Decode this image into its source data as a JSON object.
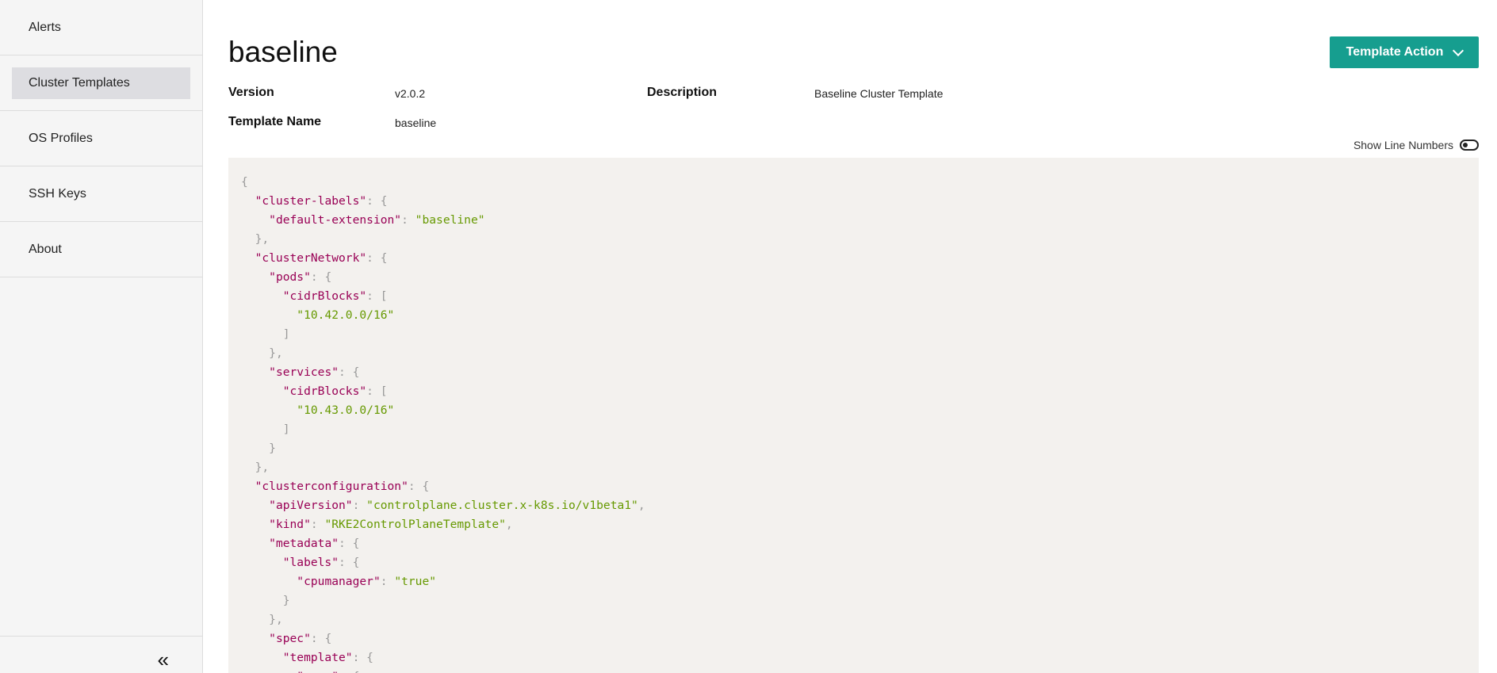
{
  "sidebar": {
    "items": [
      {
        "label": "Alerts",
        "active": false
      },
      {
        "label": "Cluster Templates",
        "active": true
      },
      {
        "label": "OS Profiles",
        "active": false
      },
      {
        "label": "SSH Keys",
        "active": false
      },
      {
        "label": "About",
        "active": false
      }
    ],
    "collapse_glyph": "«"
  },
  "header": {
    "title": "baseline",
    "action_button_label": "Template Action"
  },
  "details": {
    "version_label": "Version",
    "version_value": "v2.0.2",
    "description_label": "Description",
    "description_value": "Baseline Cluster Template",
    "template_name_label": "Template Name",
    "template_name_value": "baseline"
  },
  "code_view": {
    "show_line_numbers_label": "Show Line Numbers",
    "show_line_numbers": false,
    "lines": [
      [
        [
          "p",
          "{"
        ]
      ],
      [
        [
          "t",
          "  "
        ],
        [
          "k",
          "\"cluster-labels\""
        ],
        [
          "p",
          ": {"
        ]
      ],
      [
        [
          "t",
          "    "
        ],
        [
          "k",
          "\"default-extension\""
        ],
        [
          "p",
          ": "
        ],
        [
          "s",
          "\"baseline\""
        ]
      ],
      [
        [
          "t",
          "  "
        ],
        [
          "p",
          "},"
        ]
      ],
      [
        [
          "t",
          "  "
        ],
        [
          "k",
          "\"clusterNetwork\""
        ],
        [
          "p",
          ": {"
        ]
      ],
      [
        [
          "t",
          "    "
        ],
        [
          "k",
          "\"pods\""
        ],
        [
          "p",
          ": {"
        ]
      ],
      [
        [
          "t",
          "      "
        ],
        [
          "k",
          "\"cidrBlocks\""
        ],
        [
          "p",
          ": ["
        ]
      ],
      [
        [
          "t",
          "        "
        ],
        [
          "s",
          "\"10.42.0.0/16\""
        ]
      ],
      [
        [
          "t",
          "      "
        ],
        [
          "p",
          "]"
        ]
      ],
      [
        [
          "t",
          "    "
        ],
        [
          "p",
          "},"
        ]
      ],
      [
        [
          "t",
          "    "
        ],
        [
          "k",
          "\"services\""
        ],
        [
          "p",
          ": {"
        ]
      ],
      [
        [
          "t",
          "      "
        ],
        [
          "k",
          "\"cidrBlocks\""
        ],
        [
          "p",
          ": ["
        ]
      ],
      [
        [
          "t",
          "        "
        ],
        [
          "s",
          "\"10.43.0.0/16\""
        ]
      ],
      [
        [
          "t",
          "      "
        ],
        [
          "p",
          "]"
        ]
      ],
      [
        [
          "t",
          "    "
        ],
        [
          "p",
          "}"
        ]
      ],
      [
        [
          "t",
          "  "
        ],
        [
          "p",
          "},"
        ]
      ],
      [
        [
          "t",
          "  "
        ],
        [
          "k",
          "\"clusterconfiguration\""
        ],
        [
          "p",
          ": {"
        ]
      ],
      [
        [
          "t",
          "    "
        ],
        [
          "k",
          "\"apiVersion\""
        ],
        [
          "p",
          ": "
        ],
        [
          "s",
          "\"controlplane.cluster.x-k8s.io/v1beta1\""
        ],
        [
          "p",
          ","
        ]
      ],
      [
        [
          "t",
          "    "
        ],
        [
          "k",
          "\"kind\""
        ],
        [
          "p",
          ": "
        ],
        [
          "s",
          "\"RKE2ControlPlaneTemplate\""
        ],
        [
          "p",
          ","
        ]
      ],
      [
        [
          "t",
          "    "
        ],
        [
          "k",
          "\"metadata\""
        ],
        [
          "p",
          ": {"
        ]
      ],
      [
        [
          "t",
          "      "
        ],
        [
          "k",
          "\"labels\""
        ],
        [
          "p",
          ": {"
        ]
      ],
      [
        [
          "t",
          "        "
        ],
        [
          "k",
          "\"cpumanager\""
        ],
        [
          "p",
          ": "
        ],
        [
          "s",
          "\"true\""
        ]
      ],
      [
        [
          "t",
          "      "
        ],
        [
          "p",
          "}"
        ]
      ],
      [
        [
          "t",
          "    "
        ],
        [
          "p",
          "},"
        ]
      ],
      [
        [
          "t",
          "    "
        ],
        [
          "k",
          "\"spec\""
        ],
        [
          "p",
          ": {"
        ]
      ],
      [
        [
          "t",
          "      "
        ],
        [
          "k",
          "\"template\""
        ],
        [
          "p",
          ": {"
        ]
      ],
      [
        [
          "t",
          "        "
        ],
        [
          "k",
          "\"spec\""
        ],
        [
          "p",
          ": {"
        ]
      ]
    ]
  },
  "colors": {
    "accent": "#169e8f",
    "code_key": "#990055",
    "code_string": "#669900",
    "code_punct": "#999999",
    "code_bg": "#f3f1ee"
  }
}
